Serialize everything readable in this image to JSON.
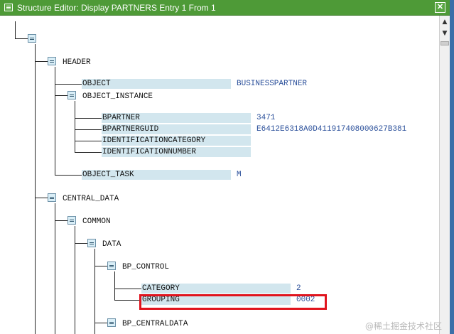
{
  "window": {
    "title": "Structure Editor: Display PARTNERS Entry 1 From 1",
    "close_label": "✕"
  },
  "tree": {
    "header": "HEADER",
    "object_instance": "OBJECT_INSTANCE",
    "central_data": "CENTRAL_DATA",
    "common": "COMMON",
    "data": "DATA",
    "bp_control": "BP_CONTROL",
    "bp_centraldata": "BP_CENTRALDATA"
  },
  "fields": {
    "object": {
      "label": "OBJECT",
      "value": "BUSINESSPARTNER"
    },
    "bpartner": {
      "label": "BPARTNER",
      "value": "3471"
    },
    "bpartnerguid": {
      "label": "BPARTNERGUID",
      "value": "E6412E6318A0D411917408000627B381"
    },
    "identificationcategory": {
      "label": "IDENTIFICATIONCATEGORY",
      "value": ""
    },
    "identificationnumber": {
      "label": "IDENTIFICATIONNUMBER",
      "value": ""
    },
    "object_task": {
      "label": "OBJECT_TASK",
      "value": "M"
    },
    "category": {
      "label": "CATEGORY",
      "value": "2"
    },
    "grouping": {
      "label": "GROUPING",
      "value": "0002"
    }
  },
  "scrollbar": {
    "up": "▲",
    "down": "▼"
  },
  "watermark": "@稀土掘金技术社区",
  "colors": {
    "titlebar": "#4e9a37",
    "field_bg": "#d2e6ee",
    "value_text": "#2a4f9a",
    "highlight": "#e0141e"
  }
}
